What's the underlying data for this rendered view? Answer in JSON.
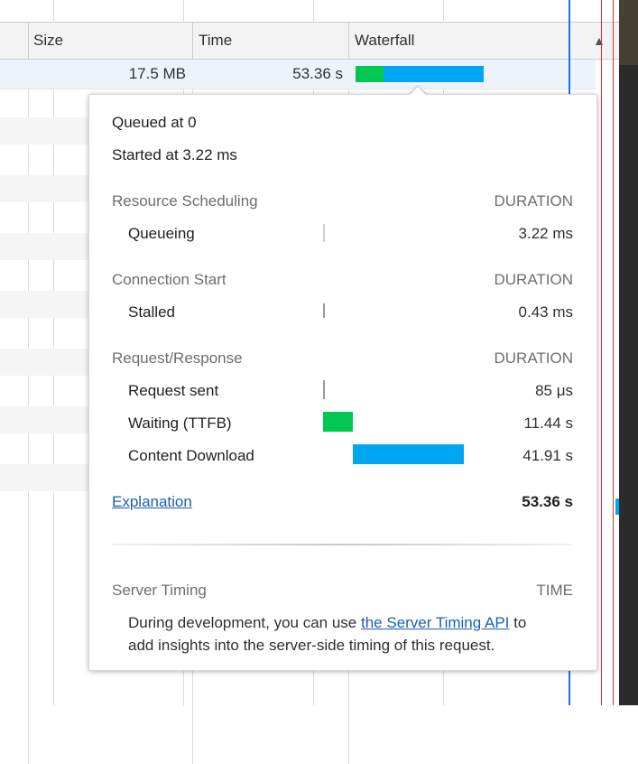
{
  "header": {
    "columns": [
      "Size",
      "Time",
      "Waterfall"
    ],
    "sort_indicator": "▲"
  },
  "selected_row": {
    "size": "17.5 MB",
    "time": "53.36 s"
  },
  "colors": {
    "waiting": "#00c853",
    "download": "#00a6f2",
    "link": "#1a5fb4"
  },
  "popover": {
    "queued": "Queued at 0",
    "started": "Started at 3.22 ms",
    "sections": [
      {
        "title": "Resource Scheduling",
        "duration_label": "DURATION",
        "rows": [
          {
            "label": "Queueing",
            "value": "3.22 ms"
          }
        ]
      },
      {
        "title": "Connection Start",
        "duration_label": "DURATION",
        "rows": [
          {
            "label": "Stalled",
            "value": "0.43 ms"
          }
        ]
      },
      {
        "title": "Request/Response",
        "duration_label": "DURATION",
        "rows": [
          {
            "label": "Request sent",
            "value": "85 μs"
          },
          {
            "label": "Waiting (TTFB)",
            "value": "11.44 s"
          },
          {
            "label": "Content Download",
            "value": "41.91 s"
          }
        ]
      }
    ],
    "explanation_link": "Explanation",
    "total": "53.36 s",
    "server_timing": {
      "title": "Server Timing",
      "time_label": "TIME",
      "text_before": "During development, you can use ",
      "link_text": "the Server Timing API",
      "text_after": " to",
      "text_line2": "add insights into the server-side timing of this request."
    }
  }
}
